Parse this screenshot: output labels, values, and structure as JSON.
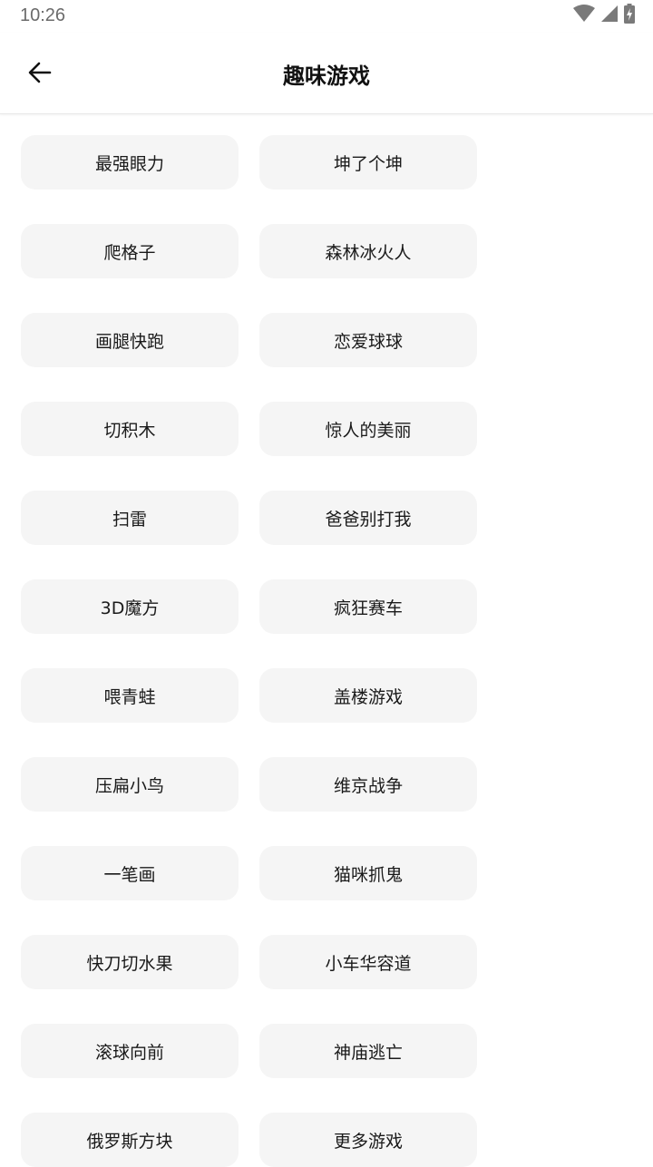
{
  "status_bar": {
    "time": "10:26",
    "icons": [
      "wifi-icon",
      "cellular-signal-icon",
      "battery-charging-icon"
    ]
  },
  "app_bar": {
    "title": "趣味游戏",
    "back_icon": "arrow-left-icon"
  },
  "colors": {
    "tile_background": "#f5f5f5",
    "text": "#111111",
    "status_icon": "#7a7a7a"
  },
  "games": [
    "最强眼力",
    "坤了个坤",
    "爬格子",
    "森林冰火人",
    "画腿快跑",
    "恋爱球球",
    "切积木",
    "惊人的美丽",
    "扫雷",
    "爸爸别打我",
    "3D魔方",
    "疯狂赛车",
    "喂青蛙",
    "盖楼游戏",
    "压扁小鸟",
    "维京战争",
    "一笔画",
    "猫咪抓鬼",
    "快刀切水果",
    "小车华容道",
    "滚球向前",
    "神庙逃亡",
    "俄罗斯方块",
    "更多游戏"
  ]
}
